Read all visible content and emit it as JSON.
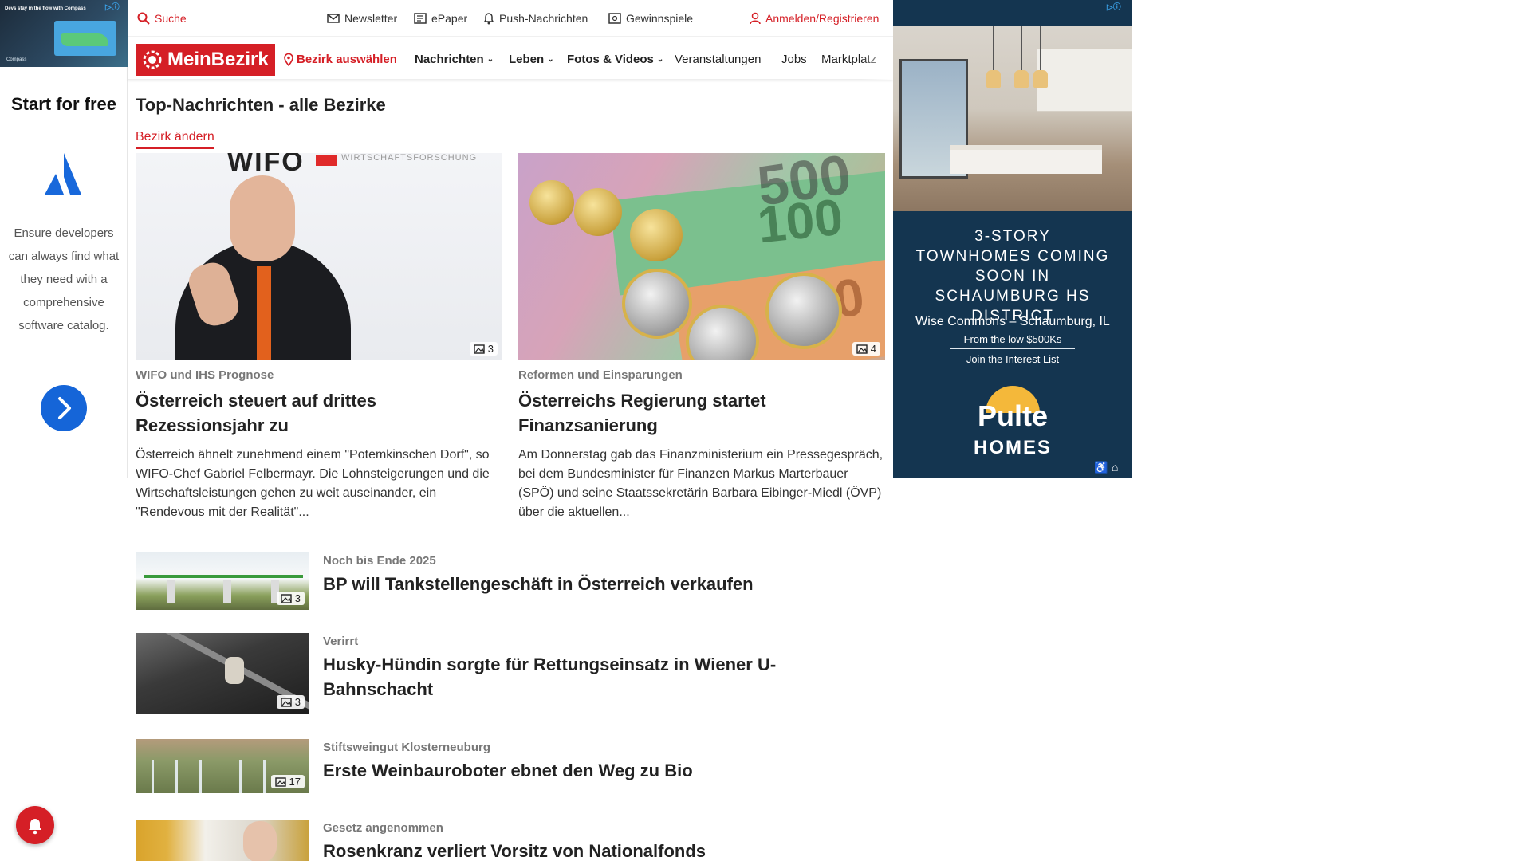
{
  "left_ad": {
    "banner_text": "Devs stay in the flow with Compass",
    "banner_brand": "Compass",
    "headline": "Start for free",
    "copy": "Ensure developers can always find what they need with a comprehensive software catalog.",
    "logo_icon": "atlassian-logo-icon",
    "cta_icon": "chevron-right-icon"
  },
  "topbar": {
    "search": "Suche",
    "newsletter": "Newsletter",
    "epaper": "ePaper",
    "push": "Push-Nachrichten",
    "contests": "Gewinnspiele",
    "login": "Anmelden/Registrieren"
  },
  "navbar": {
    "logo": "MeinBezirk",
    "district": "Bezirk auswählen",
    "items": [
      "Nachrichten",
      "Leben",
      "Fotos & Videos",
      "Veranstaltungen",
      "Jobs",
      "Marktplatz"
    ]
  },
  "page": {
    "title": "Top-Nachrichten - alle Bezirke",
    "change_district": "Bezirk ändern"
  },
  "features": [
    {
      "image_count": "3",
      "kicker": "WIFO und IHS Prognose",
      "title": "Österreich steuert auf drittes Rezessionsjahr zu",
      "teaser": "Österreich ähnelt zunehmend einem \"Potemkinschen Dorf\", so WIFO-Chef Gabriel Felbermayr. Die Lohnsteigerungen und die Wirtschaftsleistungen gehen zu weit auseinander, ein \"Rendevous mit der Realität\"...",
      "image_label": "WIFO",
      "image_sublabel": "WIRTSCHAFTSFORSCHUNG"
    },
    {
      "image_count": "4",
      "kicker": "Reformen und Einsparungen",
      "title": "Österreichs Regierung startet Finanzsanierung",
      "teaser": "Am Donnerstag gab das Finanzministerium ein Pressegespräch, bei dem Bundesminister für Finanzen Markus Marterbauer (SPÖ) und seine Staatssekretärin Barbara Eibinger-Miedl (ÖVP) über die aktuellen...",
      "note_labels": [
        "500",
        "100",
        "50"
      ]
    }
  ],
  "list": [
    {
      "kicker": "Noch bis Ende 2025",
      "title": "BP will Tankstellengeschäft in Österreich verkaufen",
      "image_count": "3"
    },
    {
      "kicker": "Verirrt",
      "title": "Husky-Hündin sorgte für Rettungseinsatz in Wiener U-Bahnschacht",
      "image_count": "3"
    },
    {
      "kicker": "Stiftsweingut Klosterneuburg",
      "title": "Erste Weinbauroboter ebnet den Weg zu Bio",
      "image_count": "17"
    },
    {
      "kicker": "Gesetz angenommen",
      "title": "Rosenkranz verliert Vorsitz von Nationalfonds"
    }
  ],
  "right_ad": {
    "headline": "3-STORY TOWNHOMES COMING SOON IN SCHAUMBURG HS DISTRICT",
    "location": "Wise Commons – Schaumburg, IL",
    "price": "From the low $500Ks",
    "cta": "Join the Interest List",
    "brand_top": "Pulte",
    "brand_bottom": "HOMES"
  },
  "colors": {
    "brand_red": "#d51f26",
    "ad_navy": "#143550"
  }
}
